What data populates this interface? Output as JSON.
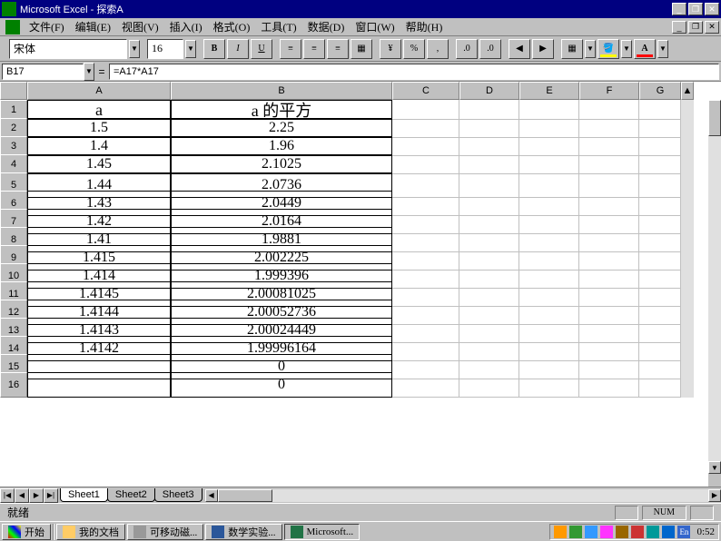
{
  "title": "Microsoft Excel - 探索A",
  "menu": [
    "文件(F)",
    "编辑(E)",
    "视图(V)",
    "插入(I)",
    "格式(O)",
    "工具(T)",
    "数据(D)",
    "窗口(W)",
    "帮助(H)"
  ],
  "font": {
    "name": "宋体",
    "size": "16"
  },
  "namebox": "B17",
  "formula": "=A17*A17",
  "columns": [
    "A",
    "B",
    "C",
    "D",
    "E",
    "F",
    "G"
  ],
  "rows": [
    {
      "n": "1",
      "a": "a",
      "b": "a 的平方",
      "tall": false,
      "hdr": true
    },
    {
      "n": "2",
      "a": "1.5",
      "b": "2.25",
      "tall": false
    },
    {
      "n": "3",
      "a": "1.4",
      "b": "1.96",
      "tall": false
    },
    {
      "n": "4",
      "a": "1.45",
      "b": "2.1025",
      "tall": false
    },
    {
      "n": "5",
      "a": "1.44",
      "b": "2.0736",
      "tall": true
    },
    {
      "n": "6",
      "a": "1.43",
      "b": "2.0449",
      "tall": true
    },
    {
      "n": "7",
      "a": "1.42",
      "b": "2.0164",
      "tall": true
    },
    {
      "n": "8",
      "a": "1.41",
      "b": "1.9881",
      "tall": true
    },
    {
      "n": "9",
      "a": "1.415",
      "b": "2.002225",
      "tall": true
    },
    {
      "n": "10",
      "a": "1.414",
      "b": "1.999396",
      "tall": true
    },
    {
      "n": "11",
      "a": "1.4145",
      "b": "2.00081025",
      "tall": true
    },
    {
      "n": "12",
      "a": "1.4144",
      "b": "2.00052736",
      "tall": true
    },
    {
      "n": "13",
      "a": "1.4143",
      "b": "2.00024449",
      "tall": true
    },
    {
      "n": "14",
      "a": "1.4142",
      "b": "1.99996164",
      "tall": true
    },
    {
      "n": "15",
      "a": "",
      "b": "0",
      "tall": true
    },
    {
      "n": "16",
      "a": "",
      "b": "0",
      "tall": true
    }
  ],
  "sheets": [
    "Sheet1",
    "Sheet2",
    "Sheet3"
  ],
  "status": "就绪",
  "status_num": "NUM",
  "start": "开始",
  "tasks": [
    "我的文档",
    "可移动磁...",
    "数学实验...",
    "Microsoft..."
  ],
  "clock": "0:52"
}
